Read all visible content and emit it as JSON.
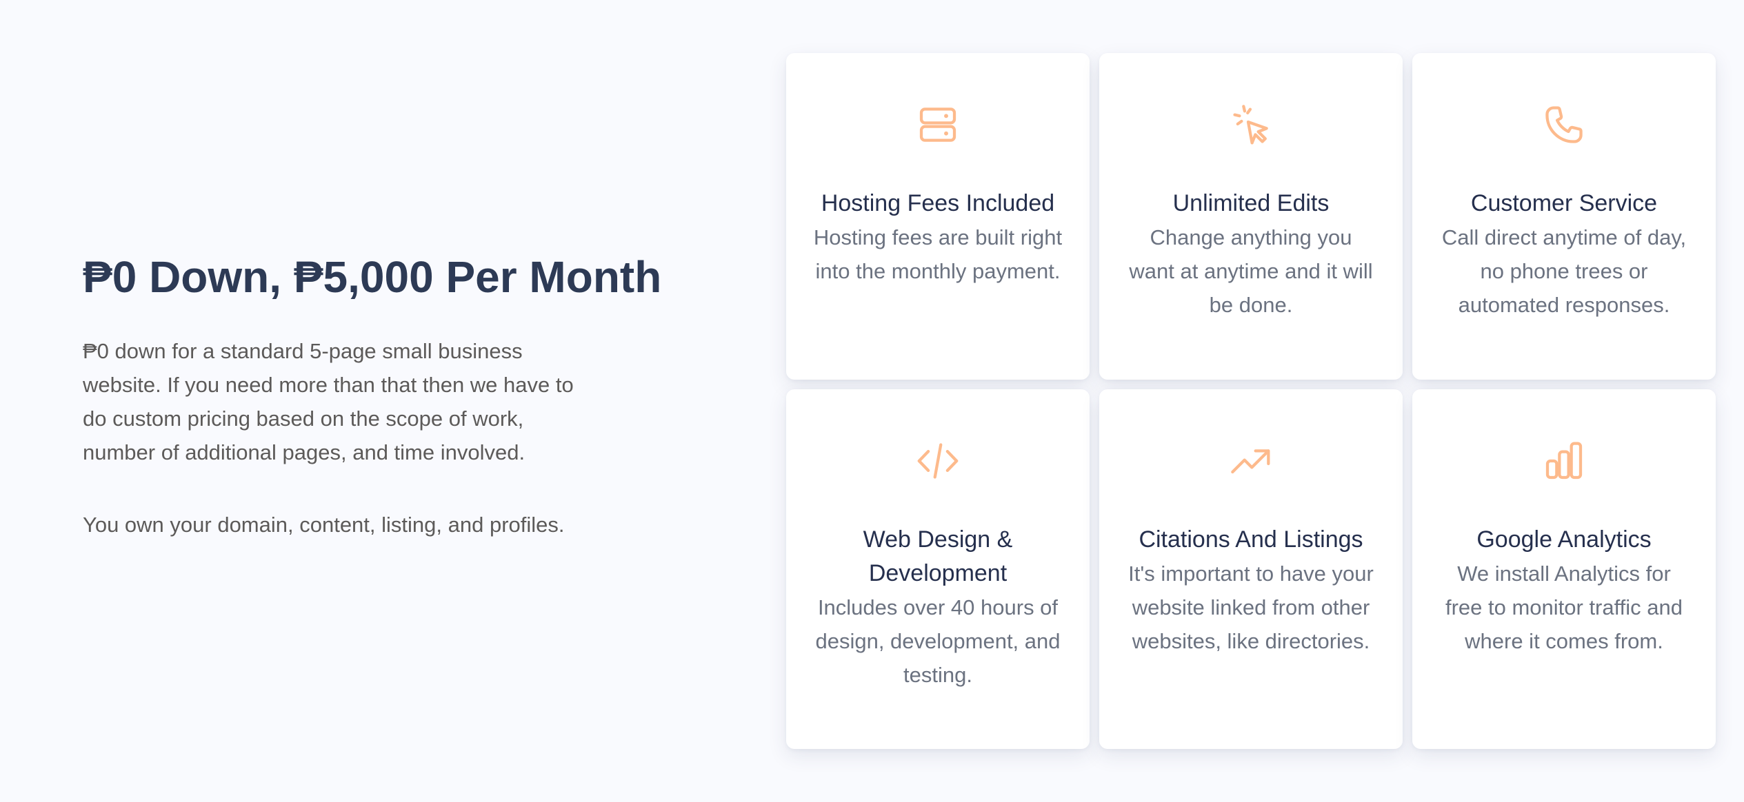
{
  "hero": {
    "headline": "₱0 Down, ₱5,000 Per Month",
    "paragraph_1": "₱0 down for a standard 5-page small business website. If you need more than that then we have to do custom pricing based on the scope of work, number of additional pages, and time involved.",
    "paragraph_2": "You own your domain, content, listing, and profiles."
  },
  "features": [
    {
      "icon": "server-icon",
      "title": "Hosting Fees Included",
      "description": "Hosting fees are built right into the monthly payment."
    },
    {
      "icon": "cursor-click-icon",
      "title": "Unlimited Edits",
      "description": "Change anything you want at anytime and it will be done."
    },
    {
      "icon": "phone-icon",
      "title": "Customer Service",
      "description": "Call direct anytime of day, no phone trees or automated responses."
    },
    {
      "icon": "code-icon",
      "title": "Web Design & Development",
      "description": "Includes over 40 hours of design, development, and testing."
    },
    {
      "icon": "trending-up-icon",
      "title": "Citations And Listings",
      "description": "It's important to have your website linked from other websites, like directories."
    },
    {
      "icon": "bar-chart-icon",
      "title": "Google Analytics",
      "description": "We install Analytics for free to monitor traffic and where it comes from."
    }
  ],
  "colors": {
    "background": "#f9fafe",
    "headline": "#2d3a55",
    "body_text": "#5c5a59",
    "card_title": "#252f4d",
    "card_text": "#6b7280",
    "icon_accent": "#fdba8c"
  }
}
